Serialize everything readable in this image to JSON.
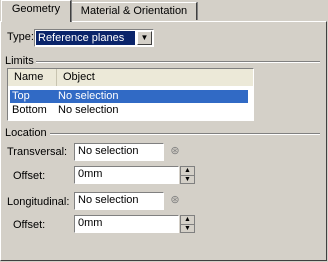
{
  "tabs": [
    "Geometry",
    "Material & Orientation"
  ],
  "type": {
    "label": "Type:",
    "value": "Reference planes"
  },
  "limits": {
    "title": "Limits",
    "columns": [
      "Name",
      "Object"
    ],
    "rows": [
      {
        "name": "Top",
        "object": "No selection"
      },
      {
        "name": "Bottom",
        "object": "No selection"
      }
    ]
  },
  "location": {
    "title": "Location",
    "transversal": {
      "label": "Transversal:",
      "value": "No selection"
    },
    "offset1": {
      "label": "Offset:",
      "value": "0mm"
    },
    "longitudinal": {
      "label": "Longitudinal:",
      "value": "No selection"
    },
    "offset2": {
      "label": "Offset:",
      "value": "0mm"
    }
  }
}
